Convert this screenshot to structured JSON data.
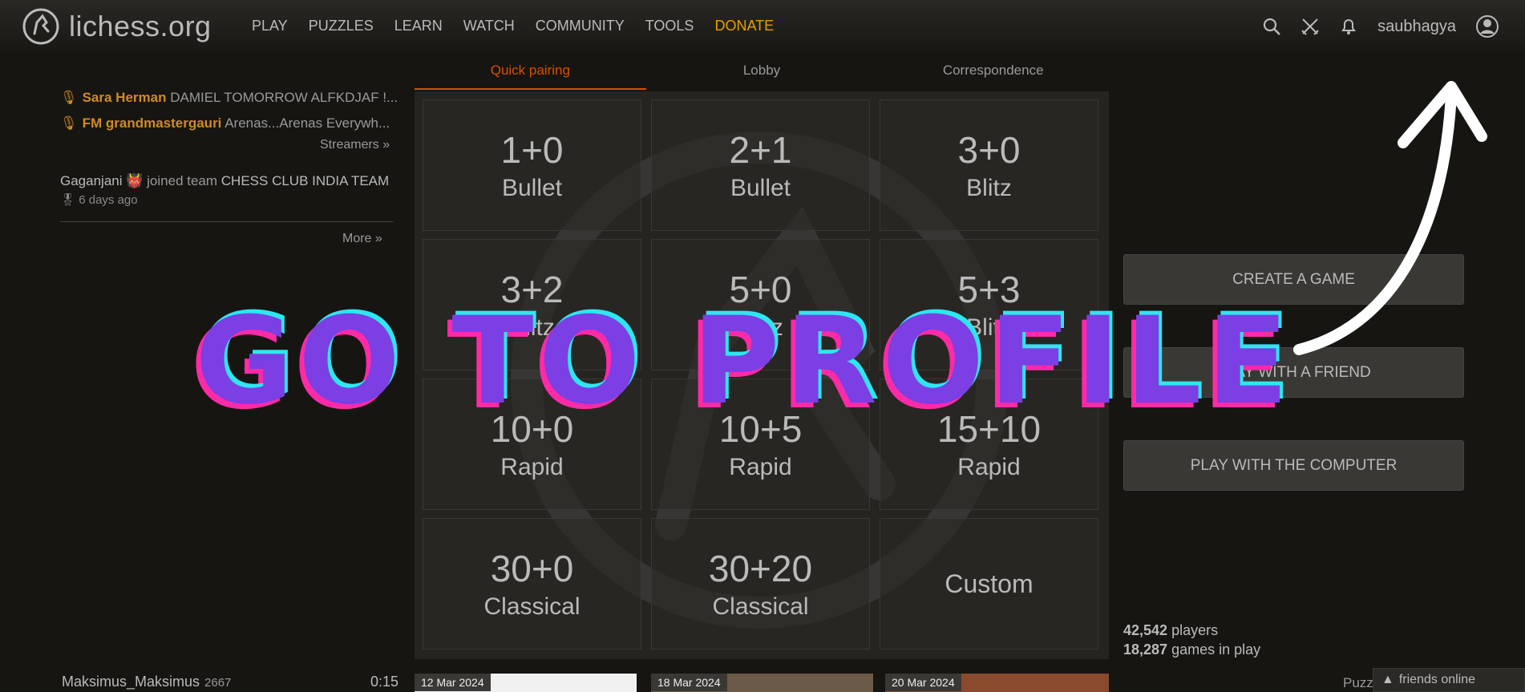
{
  "header": {
    "logo_text": "lichess.org",
    "nav": [
      "PLAY",
      "PUZZLES",
      "LEARN",
      "WATCH",
      "COMMUNITY",
      "TOOLS",
      "DONATE"
    ],
    "username": "saubhagya"
  },
  "streamers": [
    {
      "name": "Sara Herman",
      "desc": "DAMIEL TOMORROW ALFKDJAF !..."
    },
    {
      "name": "FM grandmastergauri",
      "desc": "Arenas...Arenas Everywh..."
    }
  ],
  "streamers_link": "Streamers »",
  "timeline": {
    "who": "Gaganjani",
    "emoji": "👹",
    "action": "joined team",
    "team": "CHESS CLUB INDIA TEAM",
    "ago": "6 days ago",
    "more": "More »"
  },
  "tabs": [
    "Quick pairing",
    "Lobby",
    "Correspondence"
  ],
  "pairings": [
    {
      "clock": "1+0",
      "perf": "Bullet"
    },
    {
      "clock": "2+1",
      "perf": "Bullet"
    },
    {
      "clock": "3+0",
      "perf": "Blitz"
    },
    {
      "clock": "3+2",
      "perf": "Blitz"
    },
    {
      "clock": "5+0",
      "perf": "Blitz"
    },
    {
      "clock": "5+3",
      "perf": "Blitz"
    },
    {
      "clock": "10+0",
      "perf": "Rapid"
    },
    {
      "clock": "10+5",
      "perf": "Rapid"
    },
    {
      "clock": "15+10",
      "perf": "Rapid"
    },
    {
      "clock": "30+0",
      "perf": "Classical"
    },
    {
      "clock": "30+20",
      "perf": "Classical"
    },
    {
      "clock": "",
      "perf": "Custom"
    }
  ],
  "buttons": {
    "create": "CREATE A GAME",
    "friend": "PLAY WITH A FRIEND",
    "computer": "PLAY WITH THE COMPUTER"
  },
  "counters": {
    "players_num": "42,542",
    "players_label": "players",
    "games_num": "18,287",
    "games_label": "games in play"
  },
  "bottom": {
    "player": "Maksimus_Maksimus",
    "rating": "2667",
    "time": "0:15",
    "dates": [
      "12 Mar 2024",
      "18 Mar 2024",
      "20 Mar 2024"
    ],
    "puzzle": "Puzz",
    "friends": "friends online"
  },
  "overlay_text": "GO TO PROFILE",
  "colors": {
    "accent": "#d85000",
    "donate": "#e69f00",
    "overlay_fill": "#7b3fe4",
    "overlay_cyan": "#2ee6f0",
    "overlay_pink": "#ff2aa8"
  }
}
